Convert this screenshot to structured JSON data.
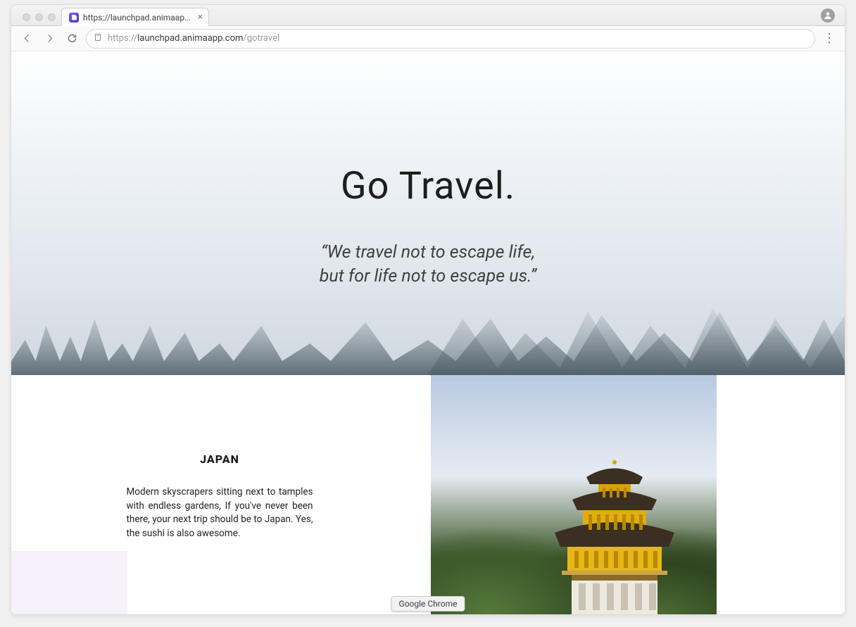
{
  "browser": {
    "tab_title": "https://launchpad.animaapp.co",
    "url_prefix": "https://",
    "url_host": "launchpad.animaapp.com",
    "url_path": "/gotravel",
    "dock_tooltip": "Google Chrome"
  },
  "hero": {
    "title": "Go Travel.",
    "quote_line1": "“We travel not to escape life,",
    "quote_line2": "but for life not to escape us.”"
  },
  "section": {
    "heading": "JAPAN",
    "body": "Modern skyscrapers sitting next to tamples with endless gardens, If you've never been there, your next trip should be to Japan. Yes, the sushi is also awesome."
  }
}
